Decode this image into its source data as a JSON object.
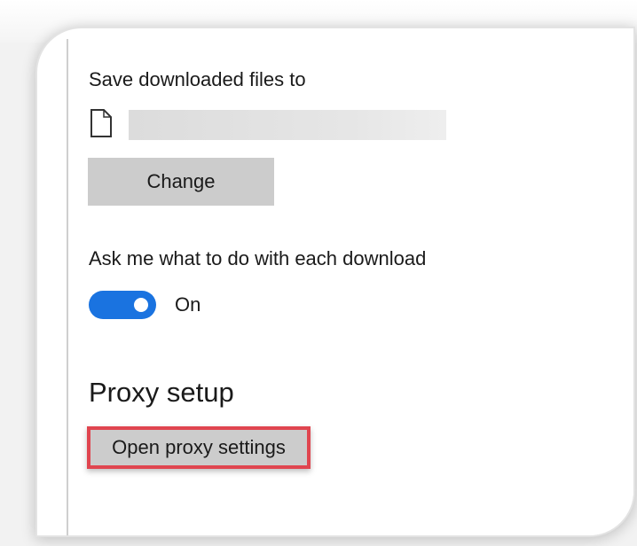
{
  "downloads": {
    "save_location_label": "Save downloaded files to",
    "save_location_path": "",
    "change_button": "Change",
    "ask_label": "Ask me what to do with each download",
    "ask_toggle": {
      "state": "On",
      "enabled": true
    }
  },
  "proxy": {
    "section_title": "Proxy setup",
    "open_button": "Open proxy settings"
  },
  "colors": {
    "toggle_accent": "#1a73e0",
    "highlight_border": "#e0454f",
    "button_bg": "#cccccc"
  },
  "icons": {
    "folder": "folder-icon"
  }
}
